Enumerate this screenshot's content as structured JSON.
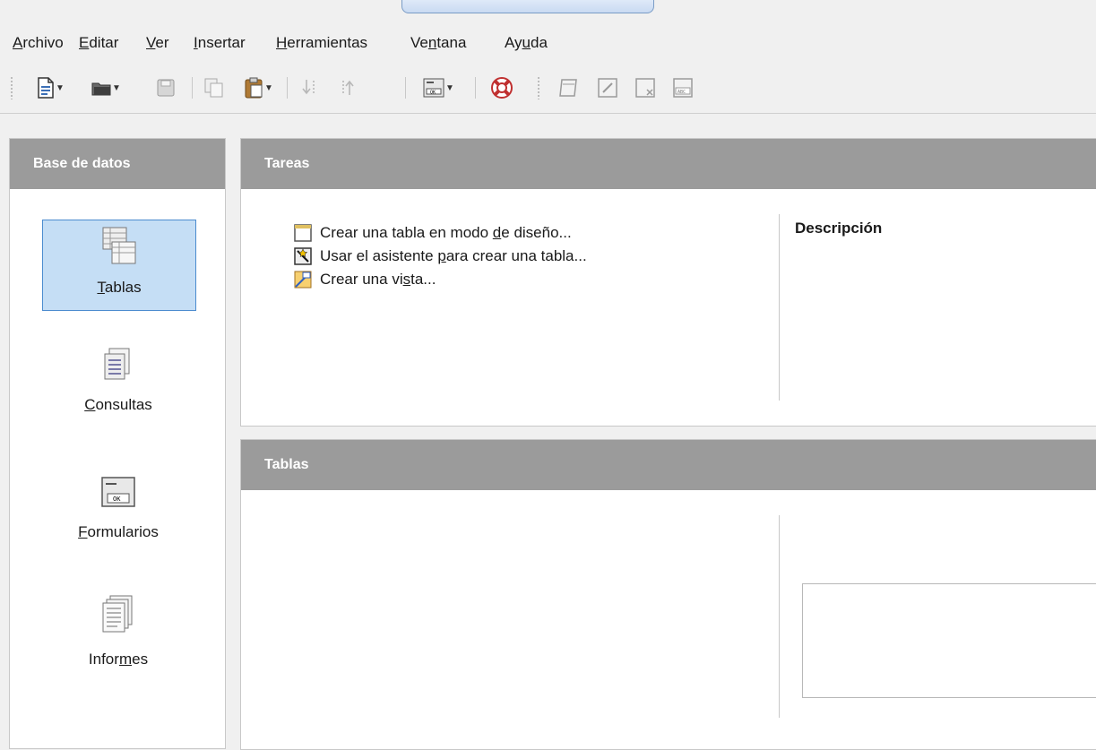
{
  "menu": [
    {
      "pre": "",
      "ul": "A",
      "post": "rchivo"
    },
    {
      "pre": "",
      "ul": "E",
      "post": "ditar"
    },
    {
      "pre": "",
      "ul": "V",
      "post": "er"
    },
    {
      "pre": "",
      "ul": "I",
      "post": "nsertar"
    },
    {
      "pre": "",
      "ul": "H",
      "post": "erramientas"
    },
    {
      "pre": "Ve",
      "ul": "n",
      "post": "tana"
    },
    {
      "pre": "Ay",
      "ul": "u",
      "post": "da"
    }
  ],
  "toolbar_icons": [
    "new-document-icon",
    "open-icon",
    "save-icon",
    "copy-icon",
    "paste-icon",
    "sort-ascending-icon",
    "sort-descending-icon",
    "form-icon",
    "help-icon",
    "open-object-icon",
    "edit-icon",
    "delete-icon",
    "rename-icon"
  ],
  "left_panel": {
    "header": "Base de datos",
    "items": [
      {
        "pre": "",
        "ul": "T",
        "post": "ablas",
        "icon": "tables-icon"
      },
      {
        "pre": "",
        "ul": "C",
        "post": "onsultas",
        "icon": "queries-icon"
      },
      {
        "pre": "",
        "ul": "F",
        "post": "ormularios",
        "icon": "forms-icon"
      },
      {
        "pre": "Infor",
        "ul": "m",
        "post": "es",
        "icon": "reports-icon"
      }
    ]
  },
  "tasks_panel": {
    "header": "Tareas",
    "tasks": [
      {
        "pre": "Crear una tabla en modo ",
        "ul": "d",
        "post": "e diseño...",
        "icon": "design-table-icon"
      },
      {
        "pre": "Usar el asistente ",
        "ul": "p",
        "post": "ara crear una tabla...",
        "icon": "wizard-icon"
      },
      {
        "pre": "Crear una vi",
        "ul": "s",
        "post": "ta...",
        "icon": "create-view-icon"
      }
    ],
    "description_title": "Descripción"
  },
  "tables_panel": {
    "header": "Tablas"
  },
  "colors": {
    "header_bg": "#9b9b9b",
    "selection_bg": "#c5def5",
    "selection_border": "#4c8ccf"
  }
}
